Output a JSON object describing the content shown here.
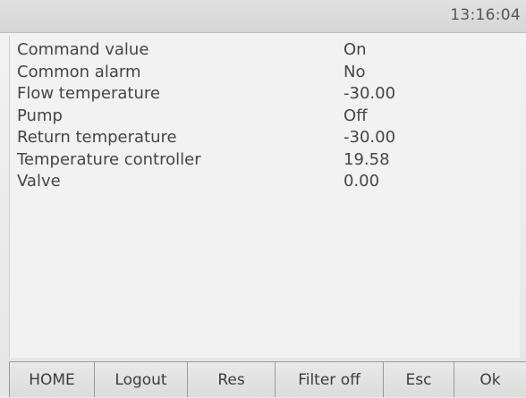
{
  "header": {
    "time": "13:16:04"
  },
  "rows": [
    {
      "label": "Command value",
      "value": "On"
    },
    {
      "label": "Common alarm",
      "value": "No"
    },
    {
      "label": "Flow temperature",
      "value": "-30.00"
    },
    {
      "label": "Pump",
      "value": "Off"
    },
    {
      "label": "Return temperature",
      "value": "-30.00"
    },
    {
      "label": "Temperature controller",
      "value": "19.58"
    },
    {
      "label": "Valve",
      "value": "0.00"
    }
  ],
  "footer": {
    "home": "HOME",
    "logout": "Logout",
    "res": "Res",
    "filter": "Filter off",
    "esc": "Esc",
    "ok": "Ok"
  }
}
